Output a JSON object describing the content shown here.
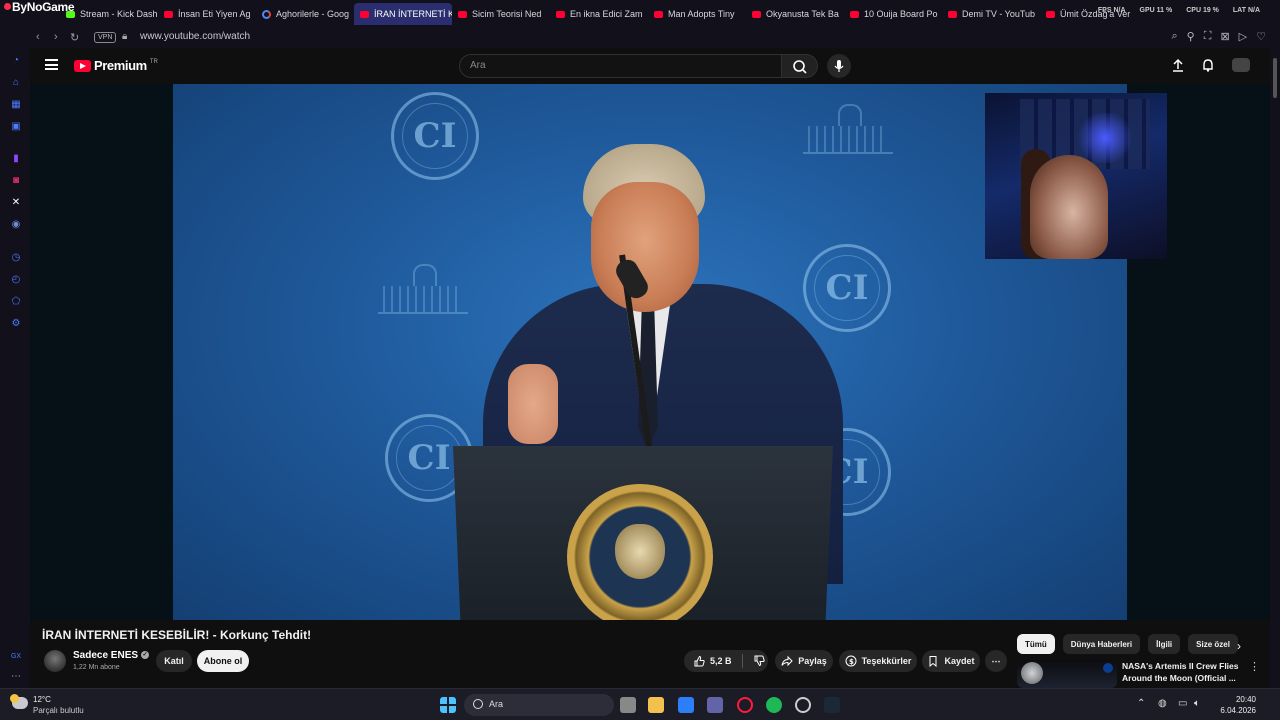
{
  "browser": {
    "brand": "ByNoGame",
    "tabs": [
      {
        "label": "Stream - Kick Dash",
        "fav": "kick",
        "active": false
      },
      {
        "label": "İnsan Eti Yiyen Ag",
        "fav": "youtube",
        "active": false
      },
      {
        "label": "Aghorilerle - Goog",
        "fav": "google",
        "active": false
      },
      {
        "label": "İRAN İNTERNETİ KESEBİL",
        "fav": "youtube",
        "active": true
      },
      {
        "label": "Sicim Teorisi Ned",
        "fav": "youtube",
        "active": false
      },
      {
        "label": "En ikna Edici Zam",
        "fav": "youtube",
        "active": false
      },
      {
        "label": "Man Adopts Tiny",
        "fav": "youtube",
        "active": false
      },
      {
        "label": "Okyanusta Tek Ba",
        "fav": "youtube",
        "active": false
      },
      {
        "label": "10 Ouija Board Po",
        "fav": "youtube",
        "active": false
      },
      {
        "label": "Demi TV - YouTub",
        "fav": "youtube",
        "active": false
      },
      {
        "label": "Ümit Özdağ'a Ver",
        "fav": "youtube",
        "active": false
      }
    ],
    "stats": [
      "FPS N/A",
      "GPU 11 %",
      "CPU 19 %",
      "LAT N/A"
    ],
    "vpn_label": "VPN",
    "url": "www.youtube.com/watch"
  },
  "youtube": {
    "logo_text": "Premium",
    "logo_region": "TR",
    "search_placeholder": "Ara",
    "video": {
      "title": "İRAN İNTERNETİ KESEBİLİR! - Korkunç Tehdit!",
      "backdrop_logo_text": "CI"
    },
    "channel": {
      "name": "Sadece ENES",
      "subscribers": "1,22 Mn abone",
      "join_label": "Katıl",
      "subscribe_label": "Abone ol"
    },
    "actions": {
      "likes": "5,2 B",
      "share_label": "Paylaş",
      "thanks_label": "Teşekkürler",
      "save_label": "Kaydet"
    },
    "chips": [
      "Tümü",
      "Dünya Haberleri",
      "İlgili",
      "Size özel"
    ],
    "recommendation": {
      "title": "NASA's Artemis II Crew Flies Around the Moon (Official ..."
    }
  },
  "taskbar": {
    "temperature": "12°C",
    "condition": "Parçalı bulutlu",
    "search_label": "Ara",
    "time": "20:40",
    "date": "6.04.2026"
  },
  "colors": {
    "accent_red": "#ff0033",
    "gx_blue": "#4d7cff",
    "active_tab": "#2a2e6e"
  }
}
